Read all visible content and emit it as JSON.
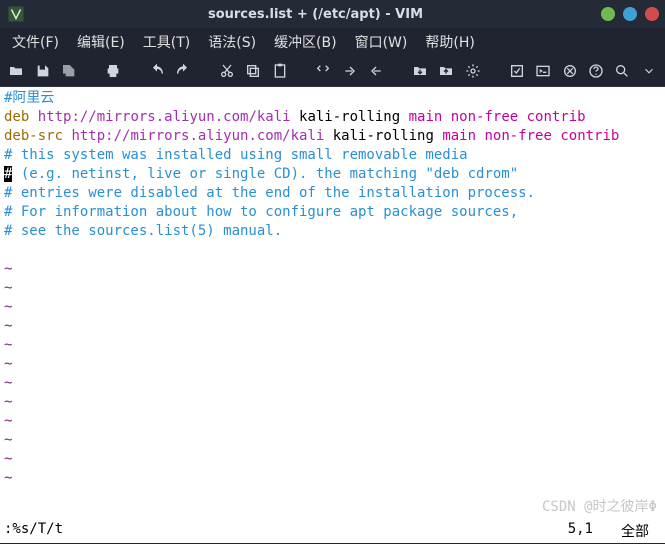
{
  "window": {
    "title": "sources.list + (/etc/apt) - VIM",
    "buttons": {
      "min": "#6fba52",
      "max": "#3ea0d6",
      "close": "#d24c4c"
    }
  },
  "menubar": [
    "文件(F)",
    "编辑(E)",
    "工具(T)",
    "语法(S)",
    "缓冲区(B)",
    "窗口(W)",
    "帮助(H)"
  ],
  "content": {
    "l1_comment": "#阿里云",
    "l2_deb": "deb",
    "l2_url": " http://mirrors.aliyun.com/kali",
    "l2_rest": " kali-rolling ",
    "l2_tail": "main non-free contrib",
    "l3_debsrc": "deb-src",
    "l3_url": " http://mirrors.aliyun.com/kali",
    "l3_rest": " kali-rolling ",
    "l3_tail": "main non-free contrib",
    "l4": "# this system was installed using small removable media",
    "l5_cursor": "#",
    "l5_rest": " (e.g. netinst, live or single CD). the matching \"deb cdrom\"",
    "l6": "# entries were disabled at the end of the installation process.",
    "l7": "# For information about how to configure apt package sources,",
    "l8": "# see the sources.list(5) manual."
  },
  "tilde": "~",
  "status": {
    "cmd": ":%s/T/t",
    "pos": "5,1",
    "pct": "全部"
  },
  "watermark": "CSDN @时之彼岸Φ"
}
